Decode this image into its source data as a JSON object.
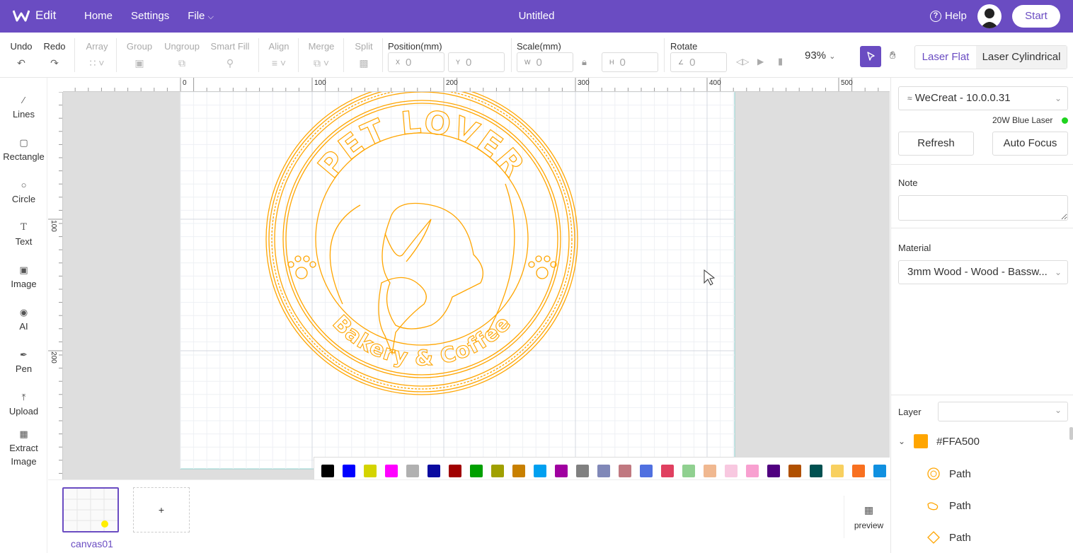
{
  "app": {
    "name": "Edit",
    "document_title": "Untitled",
    "nav": [
      "Home",
      "Settings",
      "File"
    ],
    "help_label": "Help",
    "start_label": "Start"
  },
  "toolbar": {
    "undo": "Undo",
    "redo": "Redo",
    "array": "Array",
    "group": "Group",
    "ungroup": "Ungroup",
    "smart_fill": "Smart Fill",
    "align": "Align",
    "merge": "Merge",
    "split": "Split",
    "position_label": "Position(mm)",
    "x_prefix": "X",
    "x_value": "0",
    "y_prefix": "Y",
    "y_value": "0",
    "scale_label": "Scale(mm)",
    "w_prefix": "W",
    "w_value": "0",
    "h_prefix": "H",
    "h_value": "0",
    "rotate_label": "Rotate",
    "rotate_value": "0",
    "zoom": "93%",
    "mode_flat": "Laser Flat",
    "mode_cylindrical": "Laser Cylindrical"
  },
  "left_tools": [
    "Lines",
    "Rectangle",
    "Circle",
    "Text",
    "Image",
    "AI",
    "Pen",
    "Upload",
    "Extract Image"
  ],
  "ruler": {
    "top_ticks": [
      "0",
      "100",
      "200",
      "300",
      "400",
      "500"
    ],
    "left_ticks": [
      "100",
      "200"
    ]
  },
  "design": {
    "title_text": "PET LOVER",
    "subtitle_text": "Bakery & Coffee",
    "stroke_color": "#FFA500"
  },
  "palette": [
    "#000000",
    "#0000ff",
    "#d4d400",
    "#ff00ff",
    "#b0b0b0",
    "#0a0aa0",
    "#a00000",
    "#00a000",
    "#a0a000",
    "#c88000",
    "#00a0f0",
    "#a000a0",
    "#808080",
    "#8088b8",
    "#c07880",
    "#5070e0",
    "#e04060",
    "#90d090",
    "#f0b890",
    "#f8c8e0",
    "#f8a0d0",
    "#500080",
    "#b05000",
    "#005050",
    "#f8d060",
    "#f87020",
    "#1090e0"
  ],
  "canvases": {
    "items": [
      "canvas01"
    ],
    "add_label": "+",
    "preview_label": "preview"
  },
  "right_panel": {
    "device": "WeCreat - 10.0.0.31",
    "laser": "20W Blue Laser",
    "refresh": "Refresh",
    "auto_focus": "Auto Focus",
    "note_label": "Note",
    "note_value": "",
    "material_label": "Material",
    "material_value": "3mm Wood - Wood - Bassw...",
    "layer_label": "Layer",
    "layer_color_name": "#FFA500",
    "paths": [
      "Path",
      "Path",
      "Path"
    ]
  }
}
